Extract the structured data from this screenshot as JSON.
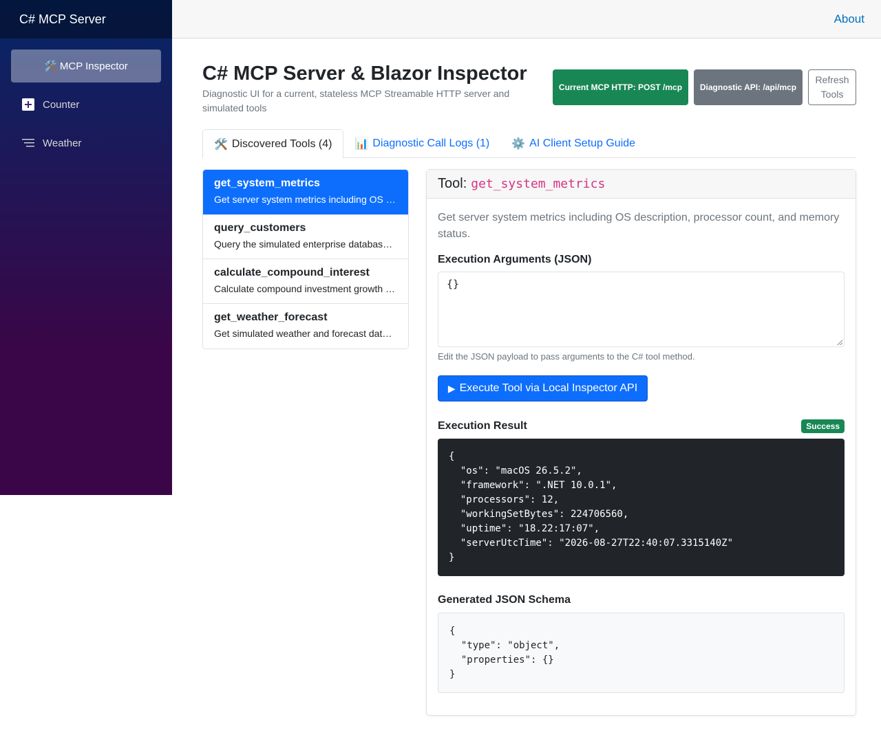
{
  "sidebar": {
    "brand": "C# MCP Server",
    "items": [
      {
        "icon": "🛠️",
        "label": "MCP Inspector"
      },
      {
        "icon": "plus-square-icon",
        "label": "Counter"
      },
      {
        "icon": "list-icon",
        "label": "Weather"
      }
    ]
  },
  "topbar": {
    "about": "About"
  },
  "header": {
    "title": "C# MCP Server & Blazor Inspector",
    "subtitle": "Diagnostic UI for a current, stateless MCP Streamable HTTP server and simulated tools",
    "badge_http": "Current MCP HTTP: POST /mcp",
    "badge_api": "Diagnostic API: /api/mcp",
    "refresh": "Refresh Tools"
  },
  "tabs": [
    {
      "icon": "🛠️",
      "label": "Discovered Tools (4)"
    },
    {
      "icon": "📊",
      "label": "Diagnostic Call Logs (1)"
    },
    {
      "icon": "⚙️",
      "label": "AI Client Setup Guide"
    }
  ],
  "tools": [
    {
      "name": "get_system_metrics",
      "desc": "Get server system metrics including OS description, processor count, and memory status."
    },
    {
      "name": "query_customers",
      "desc": "Query the simulated enterprise database for customers."
    },
    {
      "name": "calculate_compound_interest",
      "desc": "Calculate compound investment growth over time."
    },
    {
      "name": "get_weather_forecast",
      "desc": "Get simulated weather and forecast data for a city."
    }
  ],
  "detail": {
    "tool_label": "Tool:",
    "tool_name": "get_system_metrics",
    "description": "Get server system metrics including OS description, processor count, and memory status.",
    "args_title": "Execution Arguments (JSON)",
    "args_value": "{}",
    "args_help": "Edit the JSON payload to pass arguments to the C# tool method.",
    "execute_label": "Execute Tool via Local Inspector API",
    "result_title": "Execution Result",
    "result_status": "Success",
    "result_json": "{\n  \"os\": \"macOS 26.5.2\",\n  \"framework\": \".NET 10.0.1\",\n  \"processors\": 12,\n  \"workingSetBytes\": 224706560,\n  \"uptime\": \"18.22:17:07\",\n  \"serverUtcTime\": \"2026-08-27T22:40:07.3315140Z\"\n}",
    "schema_title": "Generated JSON Schema",
    "schema_json": "{\n  \"type\": \"object\",\n  \"properties\": {}\n}"
  },
  "colors": {
    "primary": "#0d6efd",
    "success": "#198754",
    "secondary": "#6c757d",
    "code_pink": "#d63384",
    "sidebar_top": "#052767",
    "sidebar_bottom": "#3a0647"
  }
}
